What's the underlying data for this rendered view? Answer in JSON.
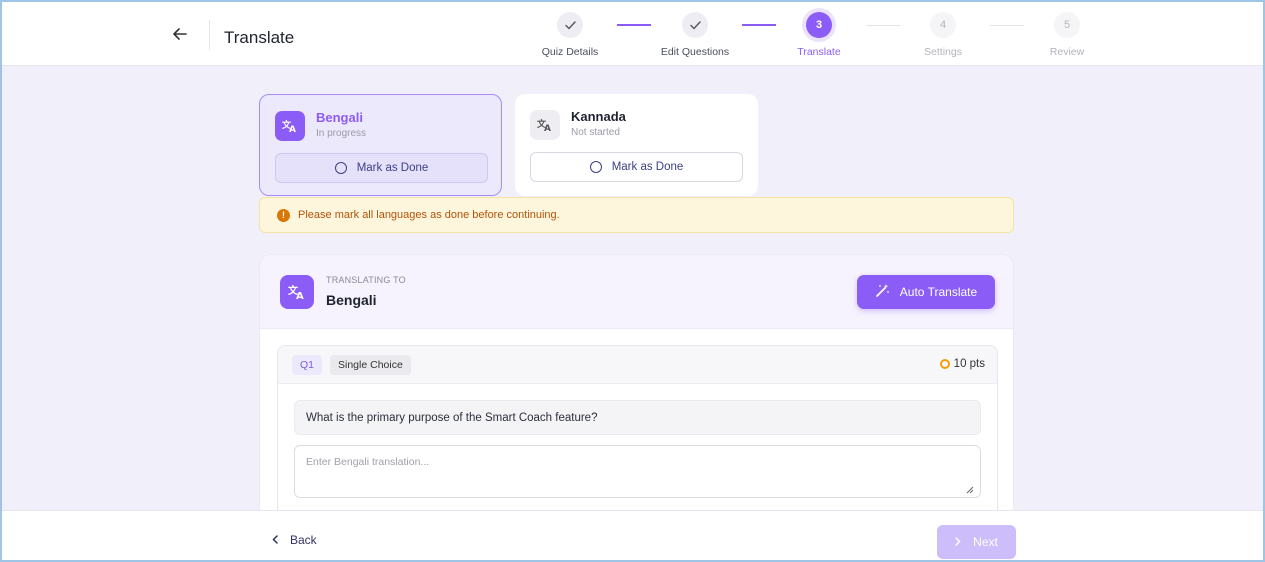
{
  "header": {
    "title": "Translate",
    "steps": [
      {
        "number": "✓",
        "label": "Quiz Details",
        "state": "done"
      },
      {
        "number": "✓",
        "label": "Edit Questions",
        "state": "done"
      },
      {
        "number": "3",
        "label": "Translate",
        "state": "active"
      },
      {
        "number": "4",
        "label": "Settings",
        "state": "future"
      },
      {
        "number": "5",
        "label": "Review",
        "state": "future"
      }
    ]
  },
  "languages": [
    {
      "name": "Bengali",
      "status": "In progress",
      "action": "Mark as Done",
      "icon": "translate-icon"
    },
    {
      "name": "Kannada",
      "status": "Not started",
      "action": "Mark as Done",
      "icon": "translate-icon"
    }
  ],
  "warning": {
    "text": "Please mark all languages as done before continuing.",
    "icon": "info-icon"
  },
  "panel": {
    "caption": "TRANSLATING TO",
    "language": "Bengali",
    "auto_translate_label": "Auto Translate"
  },
  "question": {
    "badge": "Q1",
    "type": "Single Choice",
    "points": "10 pts",
    "text": "What is the primary purpose of the Smart Coach feature?",
    "translation_value": "",
    "translation_placeholder": "Enter Bengali translation..."
  },
  "footer": {
    "back_label": "Back",
    "next_label": "Next"
  },
  "colors": {
    "accent": "#8b5cf6",
    "warning_text": "#b45309",
    "warning_bg": "#fdf6dc"
  }
}
